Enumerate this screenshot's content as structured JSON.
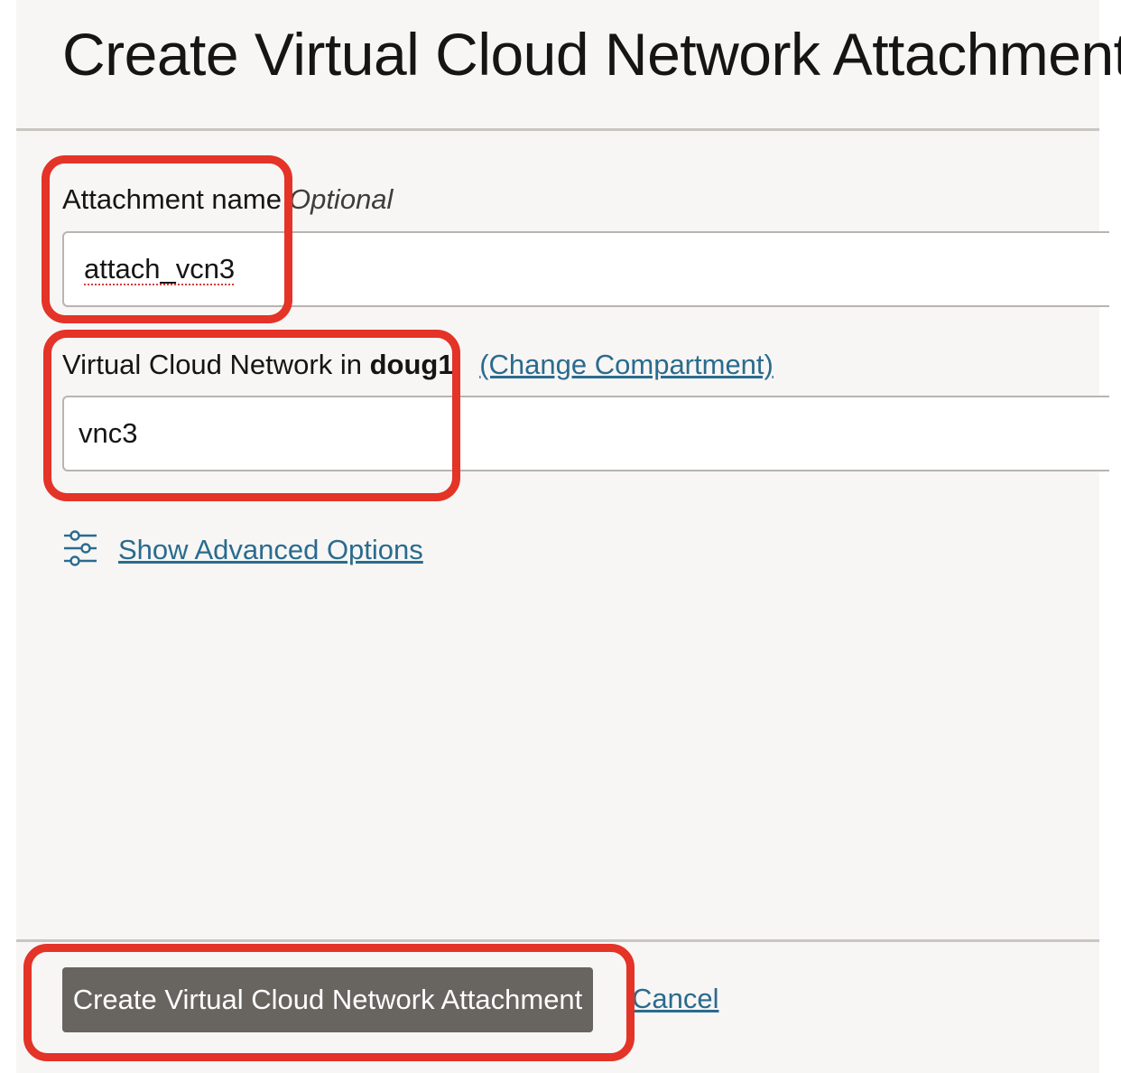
{
  "dialog": {
    "title": "Create Virtual Cloud Network Attachment"
  },
  "form": {
    "attachment_name": {
      "label": "Attachment name",
      "optional_label": "Optional",
      "value": "attach_vcn3"
    },
    "vcn": {
      "label_prefix": "Virtual Cloud Network in",
      "compartment": "doug1",
      "change_compartment_link": "(Change Compartment)",
      "value": "vnc3"
    },
    "advanced_options_link": "Show Advanced Options"
  },
  "footer": {
    "primary_button": "Create Virtual Cloud Network Attachment",
    "cancel_link": "Cancel"
  },
  "annotations": {
    "highlight_color": "#e43327"
  },
  "colors": {
    "link": "#2a6b8e",
    "primary_button": "#686460",
    "panel_background": "#f7f6f5"
  }
}
